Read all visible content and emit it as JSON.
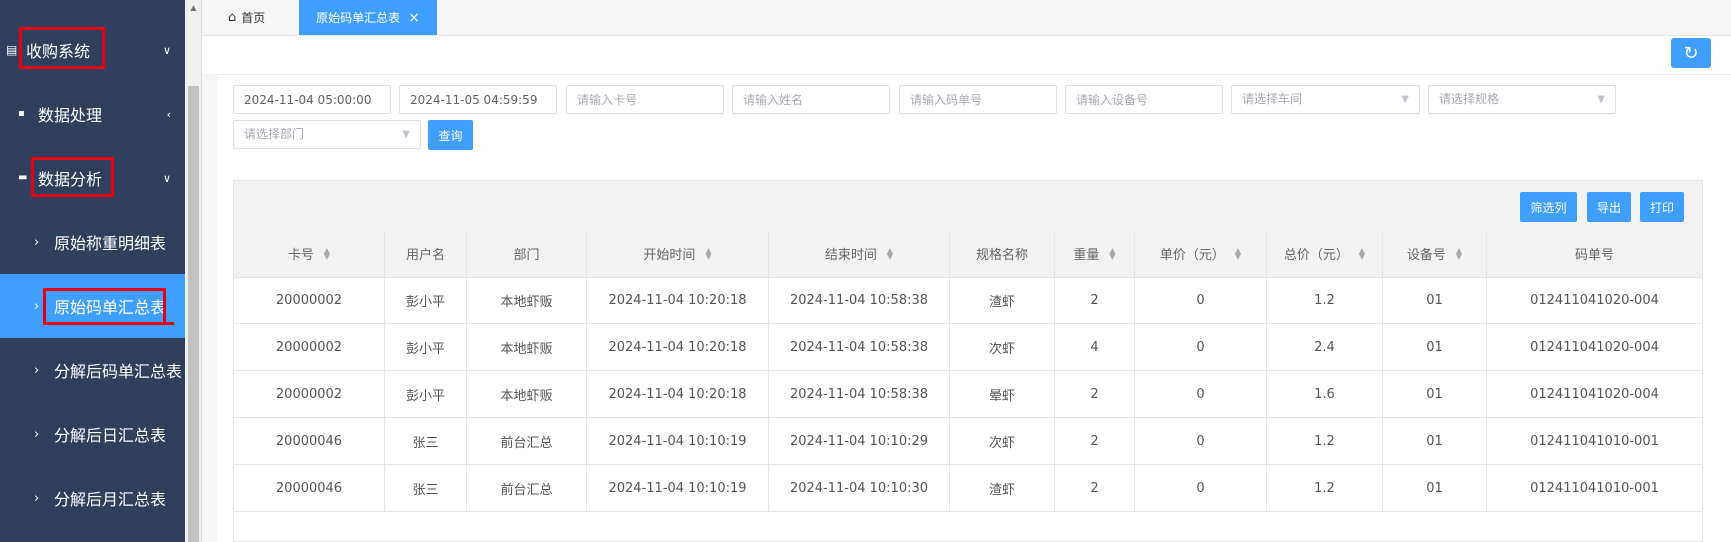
{
  "sidebar": {
    "items": [
      {
        "label": "收购系统",
        "arrow": "∨"
      },
      {
        "label": "数据处理",
        "arrow": "‹"
      },
      {
        "label": "数据分析",
        "arrow": "∨"
      },
      {
        "label": "原始称重明细表"
      },
      {
        "label": "原始码单汇总表"
      },
      {
        "label": "分解后码单汇总表"
      },
      {
        "label": "分解后日汇总表"
      },
      {
        "label": "分解后月汇总表"
      }
    ],
    "active_color": "#409eff",
    "bg_color": "#2f3f5c"
  },
  "tabs": [
    {
      "label": "首页",
      "icon": "home-icon"
    },
    {
      "label": "原始码单汇总表",
      "icon": "close-icon"
    }
  ],
  "filters": {
    "start_time": "2024-11-04 05:00:00",
    "end_time": "2024-11-05 04:59:59",
    "card_placeholder": "请输入卡号",
    "name_placeholder": "请输入姓名",
    "code_placeholder": "请输入码单号",
    "device_placeholder": "请输入设备号",
    "workshop_placeholder": "请选择车间",
    "spec_placeholder": "请选择规格",
    "dept_placeholder": "请选择部门",
    "query_label": "查询"
  },
  "toolbar": {
    "filter_columns": "筛选列",
    "export": "导出",
    "print": "打印"
  },
  "table": {
    "headers": [
      "卡号",
      "用户名",
      "部门",
      "开始时间",
      "结束时间",
      "规格名称",
      "重量",
      "单价（元）",
      "总价（元）",
      "设备号",
      "码单号"
    ],
    "rows": [
      [
        "20000002",
        "彭小平",
        "本地虾贩",
        "2024-11-04 10:20:18",
        "2024-11-04 10:58:38",
        "渣虾",
        "2",
        "0",
        "1.2",
        "01",
        "012411041020-004"
      ],
      [
        "20000002",
        "彭小平",
        "本地虾贩",
        "2024-11-04 10:20:18",
        "2024-11-04 10:58:38",
        "次虾",
        "4",
        "0",
        "2.4",
        "01",
        "012411041020-004"
      ],
      [
        "20000002",
        "彭小平",
        "本地虾贩",
        "2024-11-04 10:20:18",
        "2024-11-04 10:58:38",
        "晕虾",
        "2",
        "0",
        "1.6",
        "01",
        "012411041020-004"
      ],
      [
        "20000046",
        "张三",
        "前台汇总",
        "2024-11-04 10:10:19",
        "2024-11-04 10:10:29",
        "次虾",
        "2",
        "0",
        "1.2",
        "01",
        "012411041010-001"
      ],
      [
        "20000046",
        "张三",
        "前台汇总",
        "2024-11-04 10:10:19",
        "2024-11-04 10:10:30",
        "渣虾",
        "2",
        "0",
        "1.2",
        "01",
        "012411041010-001"
      ]
    ]
  }
}
